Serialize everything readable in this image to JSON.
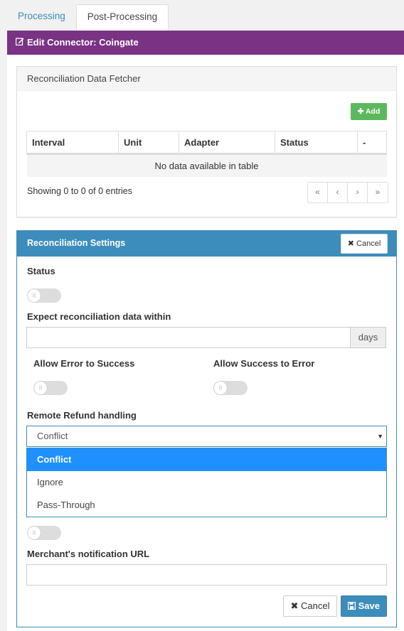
{
  "tabs": [
    {
      "label": "Processing",
      "active": false
    },
    {
      "label": "Post-Processing",
      "active": true
    }
  ],
  "header": {
    "title": "Edit Connector: Coingate",
    "icon": "edit-icon"
  },
  "fetcher": {
    "title": "Reconciliation Data Fetcher",
    "add_label": "Add",
    "columns": [
      "Interval",
      "Unit",
      "Adapter",
      "Status",
      "-"
    ],
    "empty_text": "No data available in table",
    "showing": "Showing 0 to 0 of 0 entries",
    "pager": [
      "«",
      "‹",
      "›",
      "»"
    ]
  },
  "settings": {
    "title": "Reconciliation Settings",
    "cancel_label": "Cancel",
    "status_label": "Status",
    "status_on": false,
    "expect_label": "Expect reconciliation data within",
    "expect_value": "",
    "expect_unit": "days",
    "allow_error_label": "Allow Error to Success",
    "allow_error_on": false,
    "allow_success_label": "Allow Success to Error",
    "allow_success_on": false,
    "refund_label": "Remote Refund handling",
    "refund_value": "Conflict",
    "refund_options": [
      "Conflict",
      "Ignore",
      "Pass-Through"
    ],
    "hidden_toggle_on": false,
    "url_label": "Merchant's notification URL",
    "url_value": "",
    "footer_cancel": "Cancel",
    "footer_save": "Save"
  },
  "colors": {
    "purple": "#7a3285",
    "blue": "#3c8dbc",
    "green": "#5cb85c",
    "highlight": "#1e90ff"
  }
}
